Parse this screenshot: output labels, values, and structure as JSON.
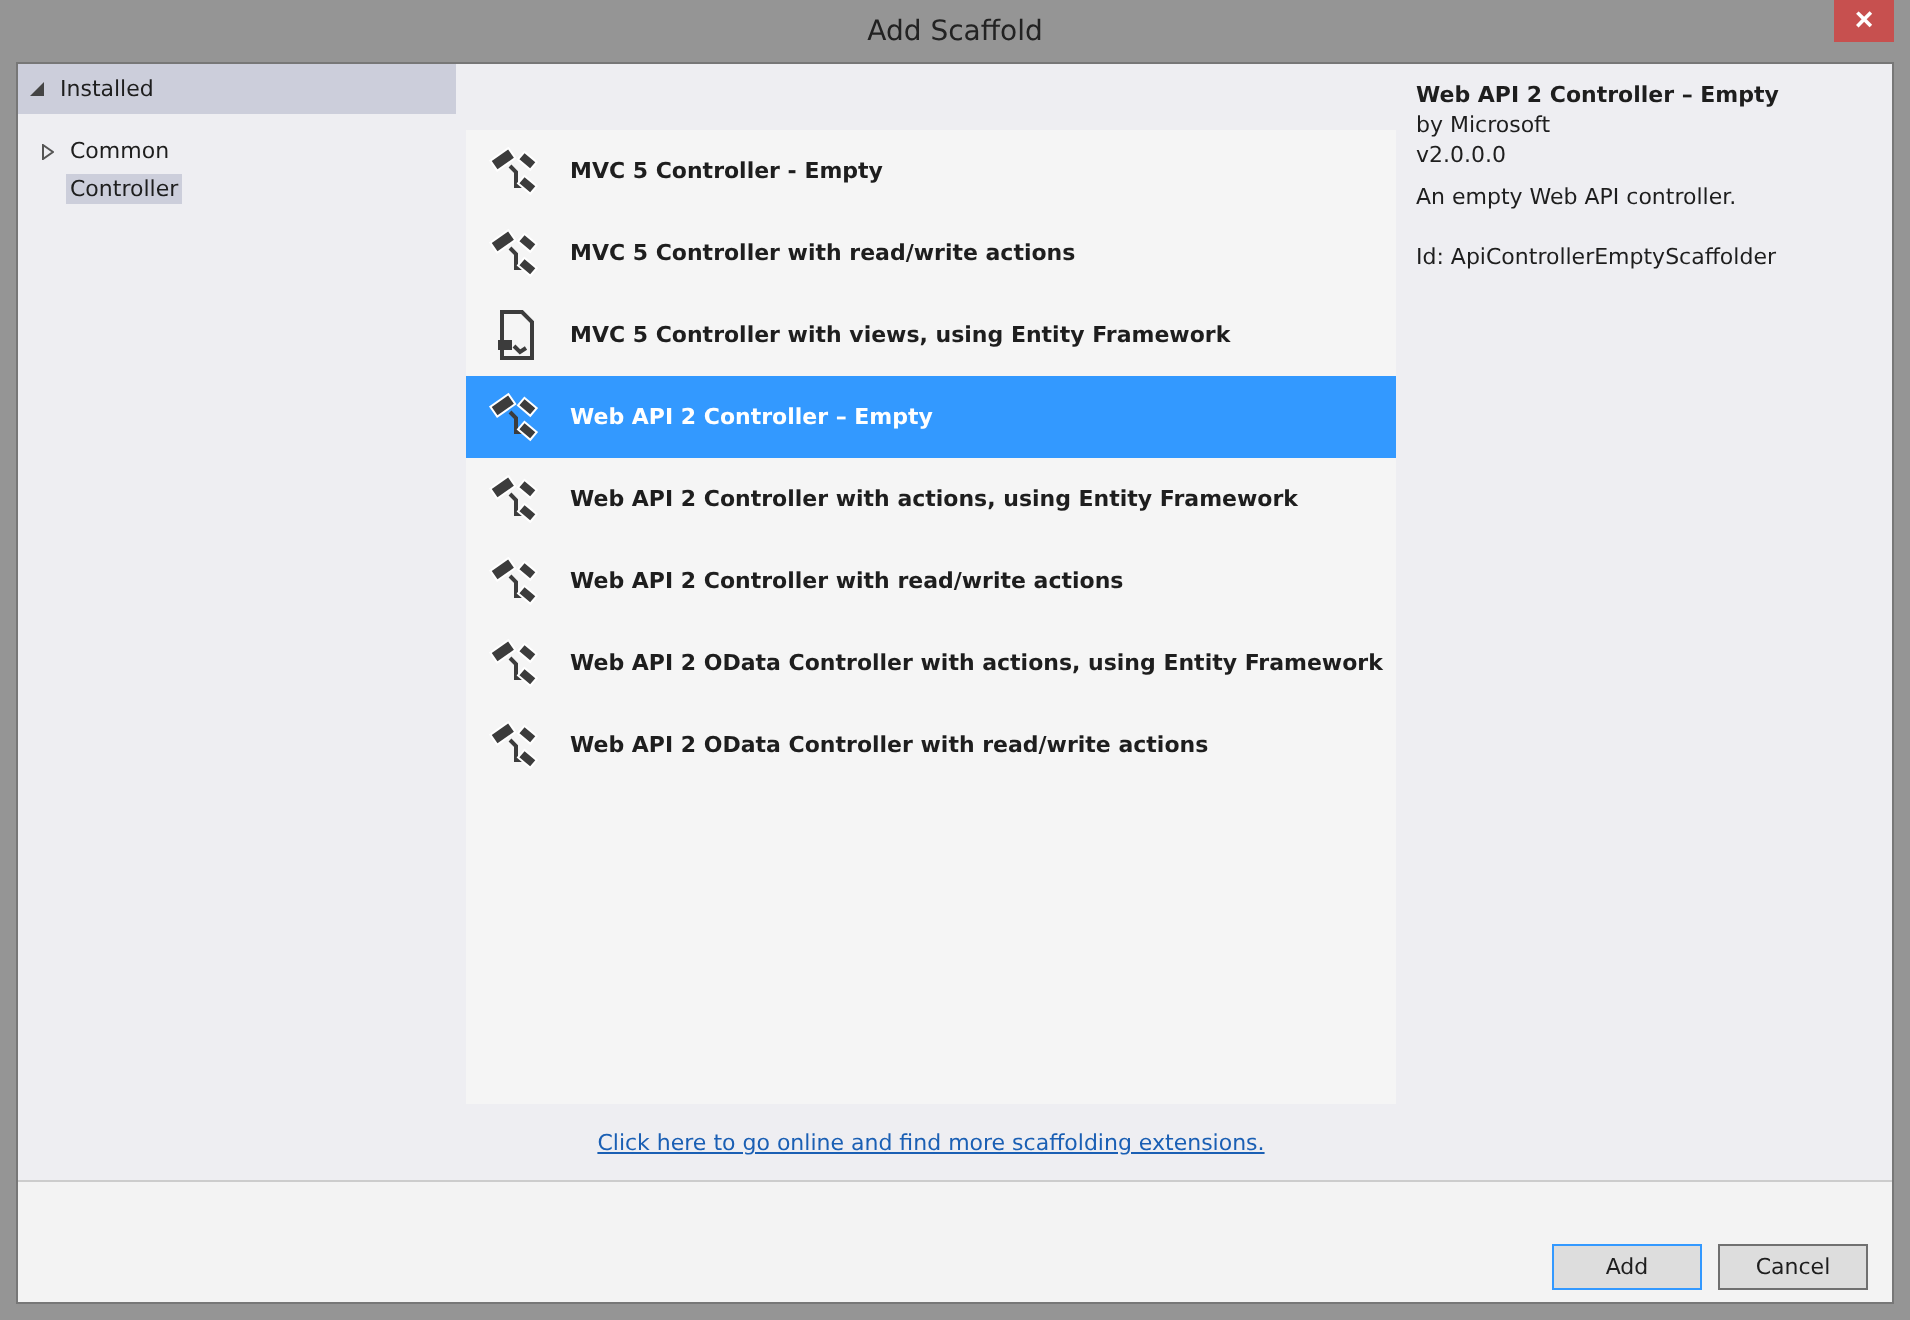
{
  "window": {
    "title": "Add Scaffold",
    "close": "×"
  },
  "sidebar": {
    "header": {
      "label": "Installed",
      "expanded": true
    },
    "items": [
      {
        "label": "Common",
        "expandable": true,
        "selected": false
      },
      {
        "label": "Controller",
        "expandable": false,
        "selected": true
      }
    ]
  },
  "templates": [
    {
      "label": "MVC 5 Controller - Empty",
      "kind": "controller",
      "selected": false
    },
    {
      "label": "MVC 5 Controller with read/write actions",
      "kind": "controller",
      "selected": false
    },
    {
      "label": "MVC 5 Controller with views, using Entity Framework",
      "kind": "document",
      "selected": false
    },
    {
      "label": "Web API 2 Controller – Empty",
      "kind": "controller",
      "selected": true
    },
    {
      "label": "Web API 2 Controller with actions, using Entity Framework",
      "kind": "controller",
      "selected": false
    },
    {
      "label": "Web API 2 Controller with read/write actions",
      "kind": "controller",
      "selected": false
    },
    {
      "label": "Web API 2 OData Controller with actions, using Entity Framework",
      "kind": "controller",
      "selected": false
    },
    {
      "label": "Web API 2 OData Controller with read/write actions",
      "kind": "controller",
      "selected": false
    }
  ],
  "details": {
    "title": "Web API 2 Controller – Empty",
    "author": "by Microsoft",
    "version": "v2.0.0.0",
    "description": "An empty Web API controller.",
    "id": "Id: ApiControllerEmptyScaffolder"
  },
  "online_link": "Click here to go online and find more scaffolding extensions.",
  "buttons": [
    {
      "label": "Add",
      "default": true
    },
    {
      "label": "Cancel",
      "default": false
    }
  ]
}
